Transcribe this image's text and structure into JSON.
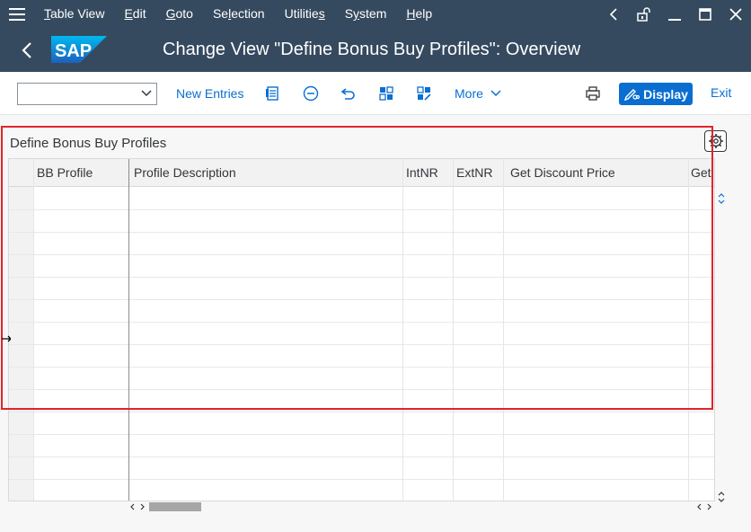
{
  "menubar": {
    "items": [
      {
        "pre": "",
        "u": "T",
        "post": "able View"
      },
      {
        "pre": "",
        "u": "E",
        "post": "dit"
      },
      {
        "pre": "",
        "u": "G",
        "post": "oto"
      },
      {
        "pre": "Se",
        "u": "l",
        "post": "ection"
      },
      {
        "pre": "Utilitie",
        "u": "s",
        "post": ""
      },
      {
        "pre": "S",
        "u": "y",
        "post": "stem"
      },
      {
        "pre": "",
        "u": "H",
        "post": "elp"
      }
    ]
  },
  "titlebar": {
    "logo_text": "SAP",
    "title": "Change View \"Define Bonus Buy Profiles\": Overview"
  },
  "toolbar": {
    "command_value": "",
    "new_entries_label": "New Entries",
    "more_label": "More",
    "display_label": "Display",
    "exit_label": "Exit"
  },
  "panel": {
    "title": "Define Bonus Buy Profiles"
  },
  "table": {
    "columns": [
      "BB Profile",
      "Profile Description",
      "IntNR",
      "ExtNR",
      "Get Discount Price",
      "Get"
    ]
  },
  "colors": {
    "shell": "#354a5f",
    "accent": "#0a6ed1",
    "highlight": "#e0252b"
  },
  "icons": [
    "hamburger-icon",
    "chevron-left-icon",
    "lock-icon",
    "minimize-icon",
    "maximize-icon",
    "close-icon",
    "chevron-down-icon",
    "document-icon",
    "minus-circle-icon",
    "undo-icon",
    "grid-icon",
    "grid-edit-icon",
    "printer-icon",
    "pencil-glasses-icon",
    "settings-icon"
  ]
}
